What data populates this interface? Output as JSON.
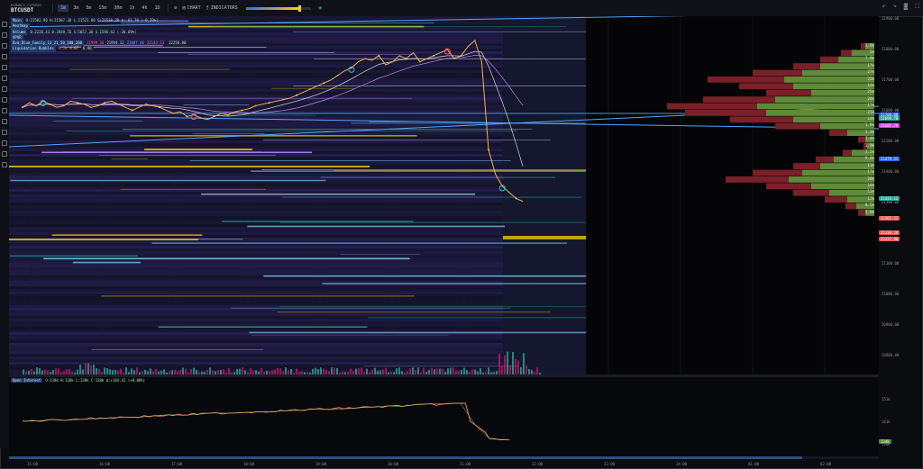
{
  "header": {
    "exchange": "BINANCE FUTURES",
    "symbol": "BTCUSDT",
    "timeframes": [
      "1m",
      "3m",
      "5m",
      "15m",
      "30m",
      "1h",
      "4h",
      "1D"
    ],
    "active_timeframe": "1m",
    "chart_button": "CHART",
    "indicators_button": "INDICATORS",
    "opacity_slider": 0.82
  },
  "legend": {
    "main": {
      "label": "Main",
      "values": "O:21502.90 H:21507.30 L:21522.00 C:21530.30 Δ:-61.70 (-0.29%)"
    },
    "heatmap": {
      "label": "Heatmap"
    },
    "volume": {
      "label": "Volume",
      "values": "B:2220.43 B:3939.76 S:5057.30 S:1596.63 (-30.69%)"
    },
    "vpvr": {
      "label": "VPVR"
    },
    "bands": {
      "label": "Dvm_Blue_Family_13_21_50_100_200",
      "v1": "21999.36",
      "v2": "21994.12",
      "v3": "22087.46",
      "v4": "22143.53",
      "v5": "22256.00"
    },
    "liq": {
      "label": "Liquidation Bubbles",
      "v1": "9.5k",
      "v2": "4.87",
      "v3": "6.96"
    }
  },
  "price_axis": {
    "ticks": [
      "21900.00",
      "21800.00",
      "21700.00",
      "21600.00",
      "21500.00",
      "21400.00",
      "21300.00",
      "21200.00",
      "21100.00",
      "21000.00",
      "20900.00",
      "20800.00"
    ],
    "tags": [
      {
        "text": "21700.00",
        "color": "#2962ff"
      },
      {
        "text": "21694.70",
        "color": "#26a69a"
      },
      {
        "text": "21687.76",
        "color": "#e040fb"
      },
      {
        "text": "21479.53",
        "color": "#2962ff"
      },
      {
        "text": "21424.12",
        "color": "#26a69a"
      },
      {
        "text": "21367.23",
        "color": "#ef5350"
      },
      {
        "text": "21334.29",
        "color": "#ef5350"
      },
      {
        "text": "21327.00",
        "color": "#ef5350"
      }
    ]
  },
  "volume_profile_labels": [
    "1.9k",
    "5k",
    "7.9k",
    "17k",
    "27k",
    "23k",
    "14k",
    "25k",
    "24k",
    "17k",
    "21k",
    "14k",
    "1.9k",
    "3.3k",
    "7.4k",
    "1.9k",
    "3.2k",
    "9.6k",
    "11k",
    "17k",
    "20k",
    "14k",
    "13k",
    "12k",
    "8.5k",
    "5.8k"
  ],
  "oi": {
    "label": "Open Interest",
    "values": "O:138k H:138k L:138k C:138k Δ:+184.41 (+0.08%)",
    "ticks": [
      "151k",
      "141k",
      "136k"
    ],
    "last": "134k"
  },
  "time_axis": [
    "15:00",
    "16:00",
    "17:00",
    "18:00",
    "19:00",
    "20:00",
    "21:00",
    "22:00",
    "23:00",
    "24:00",
    "01:00",
    "02:00"
  ],
  "chart_data": {
    "type": "line",
    "title": "",
    "xlabel": "",
    "ylabel": "",
    "ylim": [
      20760,
      21940
    ],
    "series": [
      {
        "values": [
          21640,
          21655,
          21645,
          21660,
          21650,
          21640,
          21645,
          21660,
          21655,
          21650,
          21640,
          21645,
          21655,
          21660,
          21650,
          21640,
          21630,
          21640,
          21650,
          21645,
          21640,
          21630,
          21620,
          21625,
          21610,
          21615,
          21605,
          21600,
          21610,
          21620,
          21615,
          21625,
          21630,
          21635,
          21645,
          21650,
          21655,
          21660,
          21665,
          21670,
          21680,
          21690,
          21700,
          21710,
          21720,
          21730,
          21745,
          21760,
          21770,
          21790,
          21800,
          21795,
          21810,
          21780,
          21790,
          21810,
          21800,
          21820,
          21790,
          21800,
          21810,
          21820,
          21830,
          21800,
          21810,
          21840,
          21860,
          21790,
          21500,
          21420,
          21380,
          21360,
          21340,
          21330
        ]
      }
    ]
  }
}
